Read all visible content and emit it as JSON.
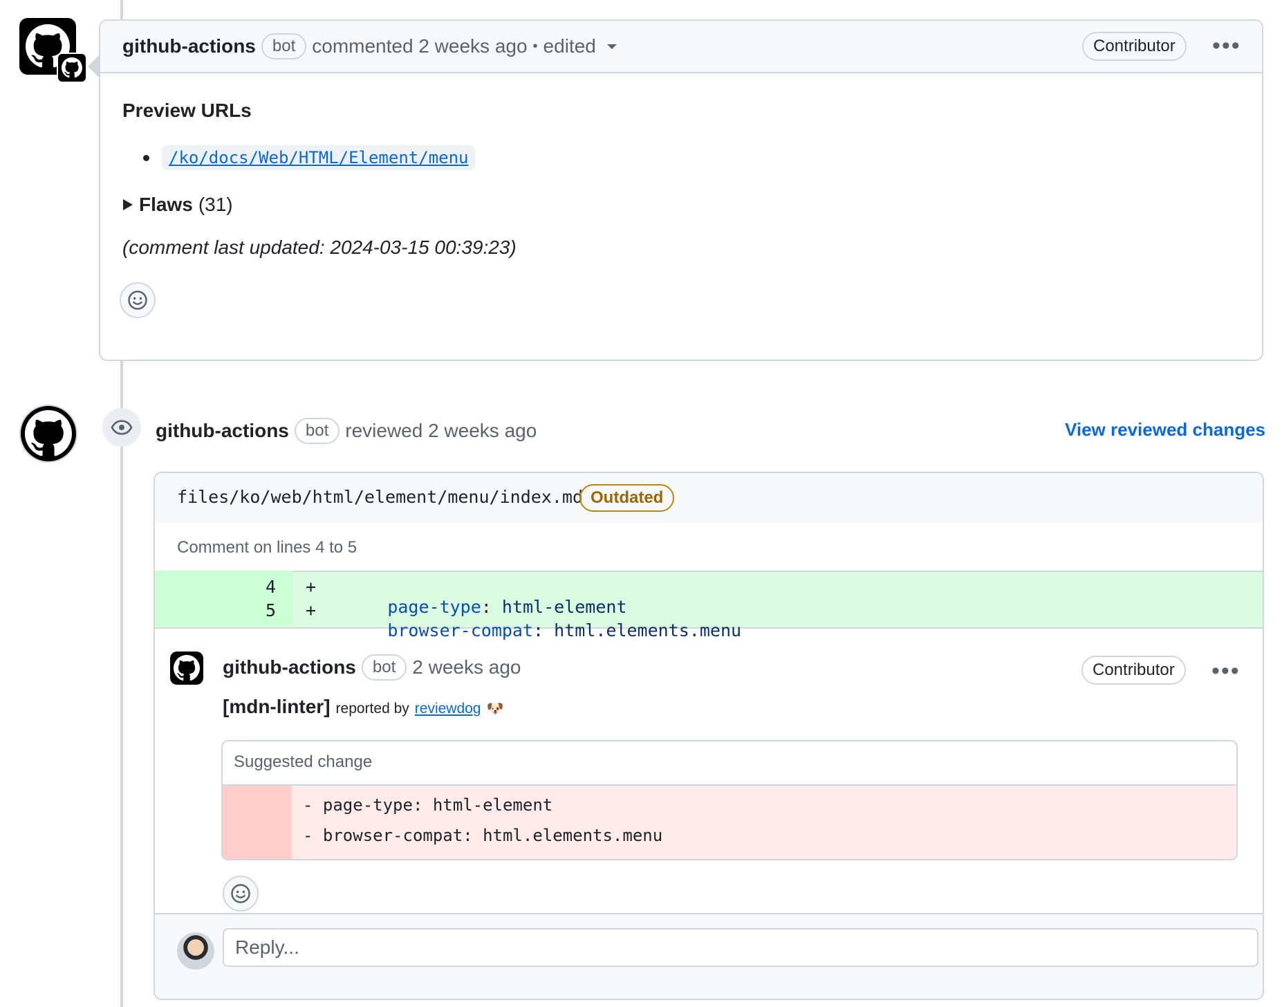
{
  "comment1": {
    "author": "github-actions",
    "bot_label": "bot",
    "meta": "commented 2 weeks ago",
    "separator": "•",
    "edited": "edited",
    "role": "Contributor",
    "more": "•••",
    "heading": "Preview URLs",
    "preview_link": "/ko/docs/Web/HTML/Element/menu",
    "flaws_label": "Flaws",
    "flaws_count": "(31)",
    "updated_note": "(comment last updated: 2024-03-15 00:39:23)"
  },
  "review": {
    "author": "github-actions",
    "bot_label": "bot",
    "meta": "reviewed 2 weeks ago",
    "view_changes": "View reviewed changes",
    "file_path": "files/ko/web/html/element/menu/index.md",
    "outdated": "Outdated",
    "lines_note": "Comment on lines 4 to 5",
    "diff_lines": [
      {
        "num": "4",
        "sign": "+",
        "key": "page-type",
        "colon": ":",
        "value": " html-element"
      },
      {
        "num": "5",
        "sign": "+",
        "key": "browser-compat",
        "colon": ":",
        "value": " html.elements.menu"
      }
    ],
    "thread": {
      "author": "github-actions",
      "bot_label": "bot",
      "meta": "2 weeks ago",
      "role": "Contributor",
      "more": "•••",
      "linter_tag": "[mdn-linter]",
      "reported_by": "reported by",
      "reporter": "reviewdog",
      "reporter_emoji": "🐶",
      "suggested_title": "Suggested change",
      "removed_lines": [
        "- page-type: html-element",
        "- browser-compat: html.elements.menu"
      ]
    },
    "reply_placeholder": "Reply..."
  }
}
